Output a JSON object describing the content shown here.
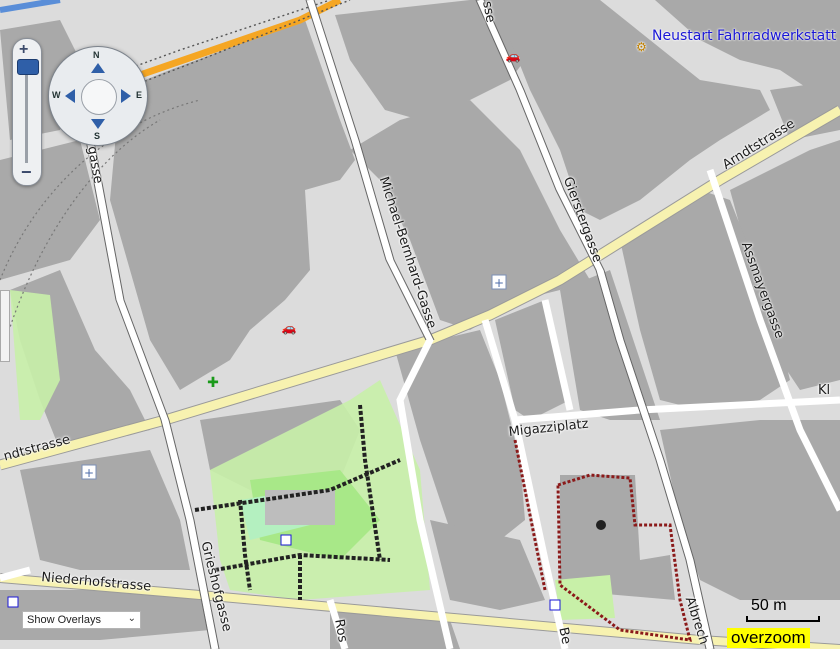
{
  "map": {
    "street_labels": [
      {
        "id": "arndtstrasse-east",
        "text": "Arndtstrasse"
      },
      {
        "id": "arndtstrasse-west",
        "text": "ndtstrasse"
      },
      {
        "id": "michael-bernhard-gasse",
        "text": "Michael-Bernhard-Gasse"
      },
      {
        "id": "gierstergasse",
        "text": "Gierstergasse"
      },
      {
        "id": "assmayergasse",
        "text": "Assmayergasse"
      },
      {
        "id": "migazziplatz",
        "text": "Migazziplatz"
      },
      {
        "id": "niederhofstrasse",
        "text": "Niederhofstrasse"
      },
      {
        "id": "gerstlgasse-fragment",
        "text": "rgasse"
      },
      {
        "id": "griesshofgasse",
        "text": "Grieshofgasse"
      },
      {
        "id": "albrecht-fragment",
        "text": "Albrech"
      },
      {
        "id": "top-fragment",
        "text": "sse"
      },
      {
        "id": "kl-fragment",
        "text": "Kl"
      },
      {
        "id": "ro-fragment",
        "text": "Ros"
      },
      {
        "id": "be-fragment",
        "text": "Be"
      }
    ],
    "poi": {
      "name": "Neustart Fahrradwerkstatt",
      "icon": "bicycle-shop-icon",
      "color": "#1a17d6"
    },
    "colors": {
      "building": "#a9a9a9",
      "ground": "#dcdcdc",
      "road": "#ffffff",
      "main_road": "#f7f2b0",
      "railway_orange": "#f5a623",
      "park": "#c8f0a8",
      "playground": "#b4f0b4"
    }
  },
  "controls": {
    "zoom_in": "+",
    "zoom_out": "−",
    "pan_directions": {
      "north": "N",
      "south": "S",
      "east": "E",
      "west": "W"
    },
    "overlay_select": {
      "value": "Show Overlays"
    }
  },
  "scale": {
    "label": "50 m"
  },
  "status": {
    "overzoom": "overzoom"
  }
}
